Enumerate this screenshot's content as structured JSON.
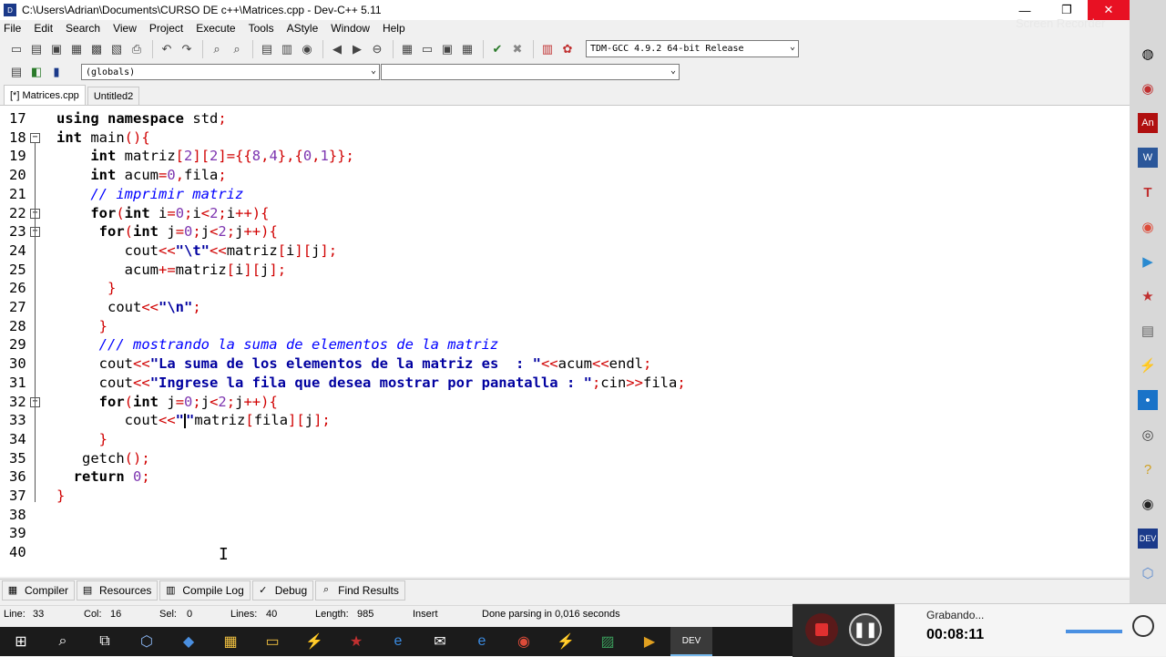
{
  "window": {
    "title": "C:\\Users\\Adrian\\Documents\\CURSO DE c++\\Matrices.cpp - Dev-C++ 5.11",
    "minimize": "—",
    "maximize": "❐",
    "close": "✕"
  },
  "menu": [
    "File",
    "Edit",
    "Search",
    "View",
    "Project",
    "Execute",
    "Tools",
    "AStyle",
    "Window",
    "Help"
  ],
  "toolbar": {
    "compiler": "TDM-GCC 4.9.2 64-bit Release",
    "scope": "(globals)",
    "symbol": ""
  },
  "tabs": [
    {
      "label": "[*] Matrices.cpp",
      "active": true
    },
    {
      "label": "Untitled2",
      "active": false
    }
  ],
  "editor": {
    "lines": [
      {
        "n": "17",
        "text": "using namespace std;"
      },
      {
        "n": "18",
        "text": "int main(){"
      },
      {
        "n": "19",
        "text": "    int matriz[2][2]={{8,4},{0,1}};"
      },
      {
        "n": "20",
        "text": "    int acum=0,fila;"
      },
      {
        "n": "21",
        "text": "    // imprimir matriz"
      },
      {
        "n": "22",
        "text": "    for(int i=0;i<2;i++){"
      },
      {
        "n": "23",
        "text": "     for(int j=0;j<2;j++){"
      },
      {
        "n": "24",
        "text": "        cout<<\"\\t\"<<matriz[i][j];"
      },
      {
        "n": "25",
        "text": "        acum+=matriz[i][j];"
      },
      {
        "n": "26",
        "text": "      }"
      },
      {
        "n": "27",
        "text": "      cout<<\"\\n\";"
      },
      {
        "n": "28",
        "text": "     }"
      },
      {
        "n": "29",
        "text": "     /// mostrando la suma de elementos de la matriz"
      },
      {
        "n": "30",
        "text": "     cout<<\"La suma de los elementos de la matriz es  : \"<<acum<<endl;"
      },
      {
        "n": "31",
        "text": "     cout<<\"Ingrese la fila que desea mostrar por panatalla : \";cin>>fila;"
      },
      {
        "n": "32",
        "text": "     for(int j=0;j<2;j++){"
      },
      {
        "n": "33",
        "text": "        cout<<\"\"matriz[fila][j];"
      },
      {
        "n": "34",
        "text": "     }"
      },
      {
        "n": "35",
        "text": "   getch();"
      },
      {
        "n": "36",
        "text": "  return 0;"
      },
      {
        "n": "37",
        "text": "}"
      },
      {
        "n": "38",
        "text": ""
      },
      {
        "n": "39",
        "text": ""
      },
      {
        "n": "40",
        "text": ""
      }
    ]
  },
  "bottom_tabs": [
    "Compiler",
    "Resources",
    "Compile Log",
    "Debug",
    "Find Results"
  ],
  "status": {
    "line_label": "Line:",
    "line": "33",
    "col_label": "Col:",
    "col": "16",
    "sel_label": "Sel:",
    "sel": "0",
    "lines_label": "Lines:",
    "lines": "40",
    "length_label": "Length:",
    "length": "985",
    "mode": "Insert",
    "message": "Done parsing in 0,016 seconds"
  },
  "recorder": {
    "status": "Grabando...",
    "time": "00:08:11"
  },
  "watermark": "Screen Recorder",
  "colors": {
    "keyword": "#000000",
    "symbol": "#d00000",
    "number": "#7d35b0",
    "string": "#0000a0",
    "comment": "#0000ff",
    "close_button": "#e81123"
  }
}
